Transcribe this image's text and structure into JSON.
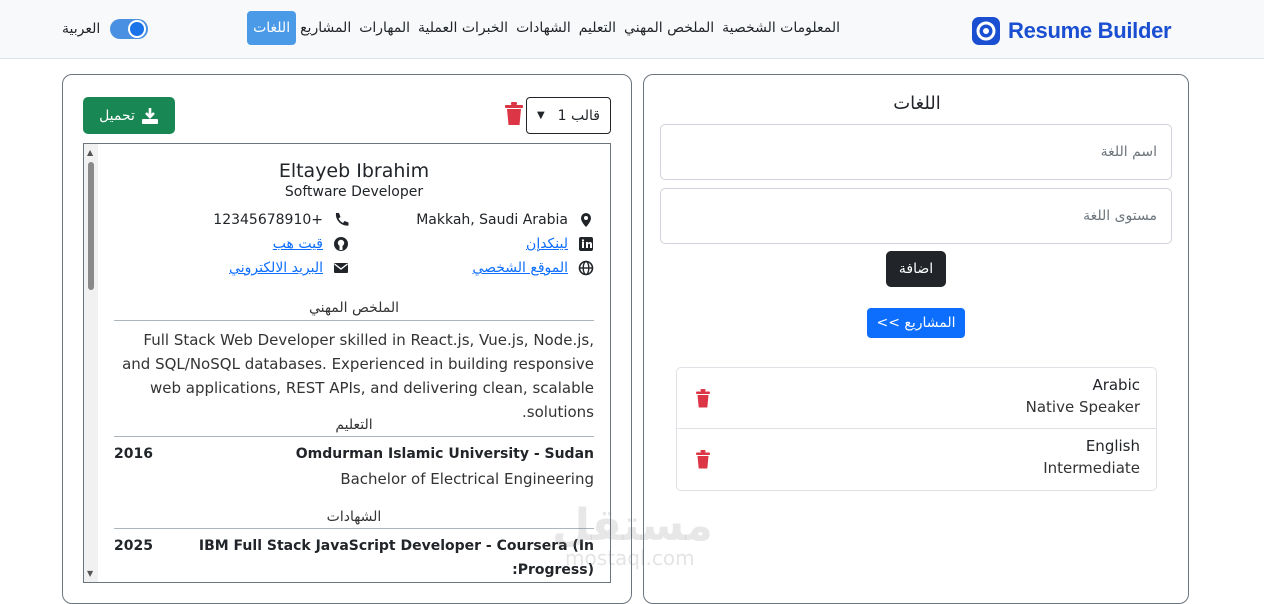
{
  "brand": {
    "name": "Resume Builder",
    "color": "#1a4fd1"
  },
  "nav": {
    "items": [
      "المعلومات الشخصية",
      "الملخص المهني",
      "التعليم",
      "الشهادات",
      "الخبرات العملية",
      "المهارات",
      "المشاريع",
      "اللغات"
    ],
    "active": "اللغات",
    "language_label": "العربية"
  },
  "preview": {
    "download_label": "تحميل",
    "template_value": "قالب 1",
    "resume": {
      "name": "Eltayeb Ibrahim",
      "title": "Software Developer",
      "location": "Makkah, Saudi Arabia",
      "phone": "12345678910+",
      "linkedin": "لينكدإن",
      "github": "قيت هب",
      "website": "الموقع الشخصي",
      "email": "البريد الالكتروني",
      "summary_heading": "الملخص المهني",
      "summary": "Full Stack Web Developer skilled in React.js, Vue.js, Node.js, and SQL/NoSQL databases. Experienced in building responsive web applications, REST APIs, and delivering clean, scalable solutions.",
      "education_heading": "التعليم",
      "education": {
        "institution": "Omdurman Islamic University - Sudan",
        "degree": "Bachelor of Electrical Engineering",
        "year": "2016"
      },
      "certifications_heading": "الشهادات",
      "certification": {
        "title_line1": "IBM Full Stack JavaScript Developer - Coursera (In",
        "title_line2": ":Progress)",
        "year": "2025"
      }
    }
  },
  "form": {
    "title": "اللغات",
    "language_placeholder": "اسم اللغة",
    "level_placeholder": "مستوى اللغة",
    "add_label": "اضافة",
    "back_label": "<< المشاريع",
    "languages": [
      {
        "name": "Arabic",
        "level": "Native Speaker"
      },
      {
        "name": "English",
        "level": "Intermediate"
      }
    ]
  },
  "watermark": {
    "main": "مستقل",
    "sub": "mostaql.com"
  },
  "colors": {
    "primary": "#0d6efd",
    "success": "#198754",
    "danger": "#dc3545",
    "dark": "#212529"
  }
}
